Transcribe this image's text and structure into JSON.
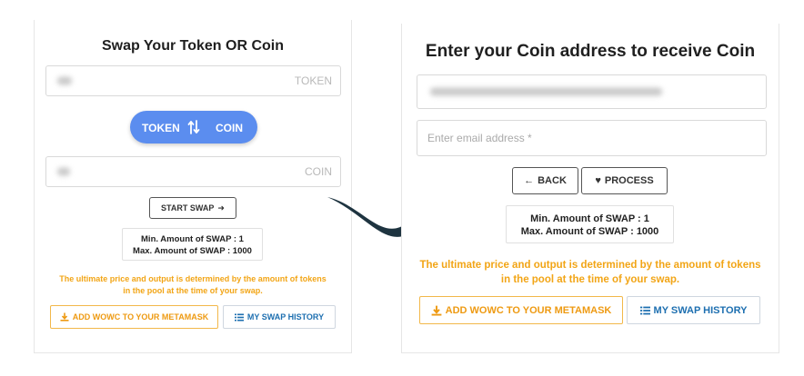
{
  "left": {
    "title": "Swap Your Token OR Coin",
    "token_field": {
      "suffix": "TOKEN"
    },
    "toggle": {
      "from": "TOKEN",
      "to": "COIN"
    },
    "coin_field": {
      "suffix": "COIN"
    },
    "start_swap": "START SWAP",
    "info": {
      "min": "Min. Amount of SWAP : 1",
      "max": "Max. Amount of SWAP : 1000"
    },
    "note": {
      "line1": "The ultimate price and output is determined by the amount of tokens",
      "line2": "in the pool at the time of your swap."
    },
    "metamask": "ADD WOWC TO YOUR METAMASK",
    "history": "MY SWAP HISTORY"
  },
  "right": {
    "title": "Enter your Coin address to receive Coin",
    "email_placeholder": "Enter email address *",
    "back": "BACK",
    "process": "PROCESS",
    "info": {
      "min": "Min. Amount of SWAP : 1",
      "max": "Max. Amount of SWAP : 1000"
    },
    "note": {
      "line1": "The ultimate price and output is determined by the amount of tokens",
      "line2": "in the pool at the time of your swap."
    },
    "metamask": "ADD WOWC TO YOUR METAMASK",
    "history": "MY SWAP HISTORY"
  },
  "colors": {
    "accent_blue": "#5b8def",
    "warning_orange": "#f2a516",
    "link_blue": "#1d6fb0",
    "arrow": "#1e3440"
  },
  "icons": [
    "swap-icon",
    "arrow-right-icon",
    "download-icon",
    "list-icon",
    "arrow-left-icon",
    "heart-icon",
    "curved-arrow-icon"
  ]
}
